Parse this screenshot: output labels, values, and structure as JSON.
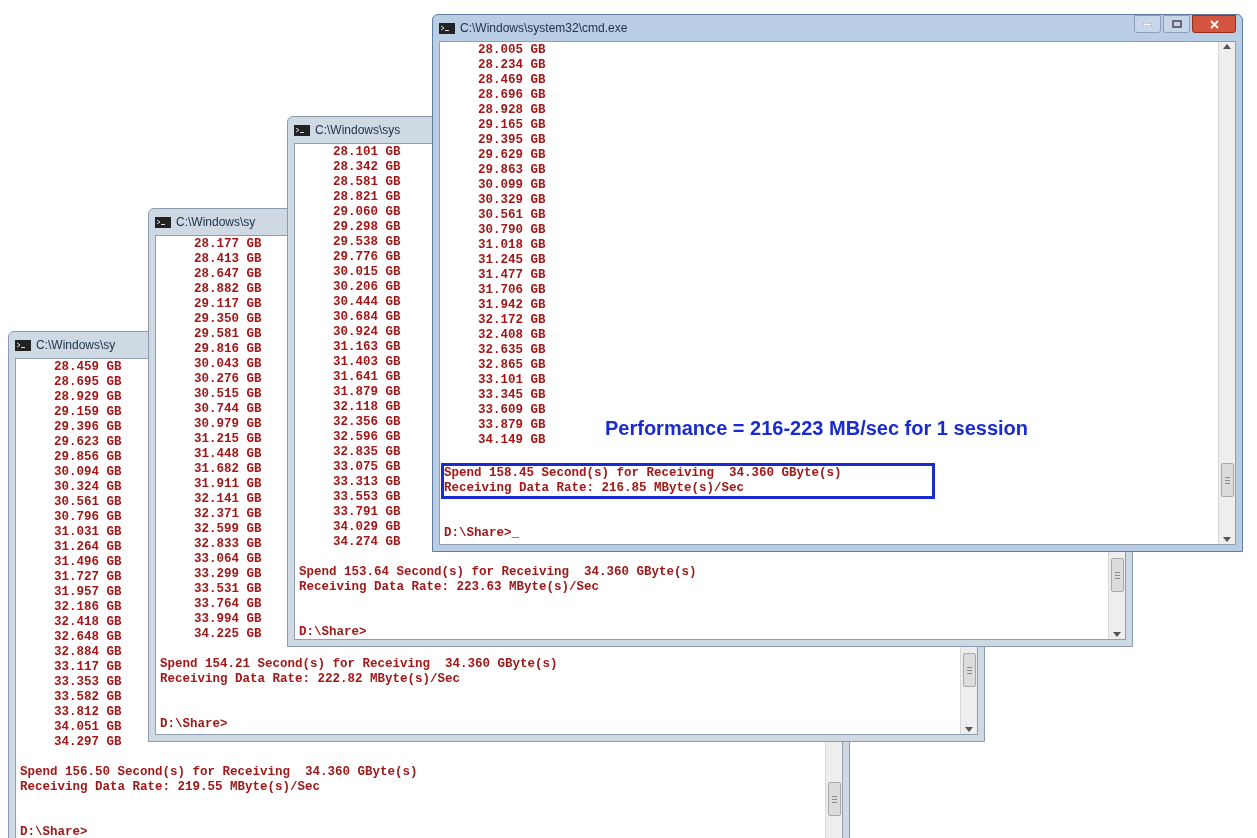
{
  "windows": [
    {
      "title": "C:\\Windows\\sy",
      "active": false,
      "lines": [
        "28.459 GB",
        "28.695 GB",
        "28.929 GB",
        "29.159 GB",
        "29.396 GB",
        "29.623 GB",
        "29.856 GB",
        "30.094 GB",
        "30.324 GB",
        "30.561 GB",
        "30.796 GB",
        "31.031 GB",
        "31.264 GB",
        "31.496 GB",
        "31.727 GB",
        "31.957 GB",
        "32.186 GB",
        "32.418 GB",
        "32.648 GB",
        "32.884 GB",
        "33.117 GB",
        "33.353 GB",
        "33.582 GB",
        "33.812 GB",
        "34.051 GB",
        "34.297 GB"
      ],
      "summary": [
        "Spend 156.50 Second(s) for Receiving  34.360 GByte(s)",
        "Receiving Data Rate: 219.55 MByte(s)/Sec"
      ],
      "highlighted": false,
      "prompt": "D:\\Share>"
    },
    {
      "title": "C:\\Windows\\sy",
      "active": false,
      "lines": [
        "28.177 GB",
        "28.413 GB",
        "28.647 GB",
        "28.882 GB",
        "29.117 GB",
        "29.350 GB",
        "29.581 GB",
        "29.816 GB",
        "30.043 GB",
        "30.276 GB",
        "30.515 GB",
        "30.744 GB",
        "30.979 GB",
        "31.215 GB",
        "31.448 GB",
        "31.682 GB",
        "31.911 GB",
        "32.141 GB",
        "32.371 GB",
        "32.599 GB",
        "32.833 GB",
        "33.064 GB",
        "33.299 GB",
        "33.531 GB",
        "33.764 GB",
        "33.994 GB",
        "34.225 GB"
      ],
      "summary": [
        "Spend 154.21 Second(s) for Receiving  34.360 GByte(s)",
        "Receiving Data Rate: 222.82 MByte(s)/Sec"
      ],
      "highlighted": false,
      "prompt": "D:\\Share>"
    },
    {
      "title": "C:\\Windows\\sys",
      "active": false,
      "lines": [
        "28.101 GB",
        "28.342 GB",
        "28.581 GB",
        "28.821 GB",
        "29.060 GB",
        "29.298 GB",
        "29.538 GB",
        "29.776 GB",
        "30.015 GB",
        "30.206 GB",
        "30.444 GB",
        "30.684 GB",
        "30.924 GB",
        "31.163 GB",
        "31.403 GB",
        "31.641 GB",
        "31.879 GB",
        "32.118 GB",
        "32.356 GB",
        "32.596 GB",
        "32.835 GB",
        "33.075 GB",
        "33.313 GB",
        "33.553 GB",
        "33.791 GB",
        "34.029 GB",
        "34.274 GB"
      ],
      "summary": [
        "Spend 153.64 Second(s) for Receiving  34.360 GByte(s)",
        "Receiving Data Rate: 223.63 MByte(s)/Sec"
      ],
      "highlighted": false,
      "prompt": "D:\\Share>"
    },
    {
      "title": "C:\\Windows\\system32\\cmd.exe",
      "active": true,
      "lines": [
        "28.005 GB",
        "28.234 GB",
        "28.469 GB",
        "28.696 GB",
        "28.928 GB",
        "29.165 GB",
        "29.395 GB",
        "29.629 GB",
        "29.863 GB",
        "30.099 GB",
        "30.329 GB",
        "30.561 GB",
        "30.790 GB",
        "31.018 GB",
        "31.245 GB",
        "31.477 GB",
        "31.706 GB",
        "31.942 GB",
        "32.172 GB",
        "32.408 GB",
        "32.635 GB",
        "32.865 GB",
        "33.101 GB",
        "33.345 GB",
        "33.609 GB",
        "33.879 GB",
        "34.149 GB"
      ],
      "summary": [
        "Spend 158.45 Second(s) for Receiving  34.360 GByte(s)",
        "Receiving Data Rate: 216.85 MByte(s)/Sec"
      ],
      "highlighted": true,
      "prompt": "D:\\Share>_"
    }
  ],
  "annotation": "Performance = 216-223 MB/sec for 1 session"
}
